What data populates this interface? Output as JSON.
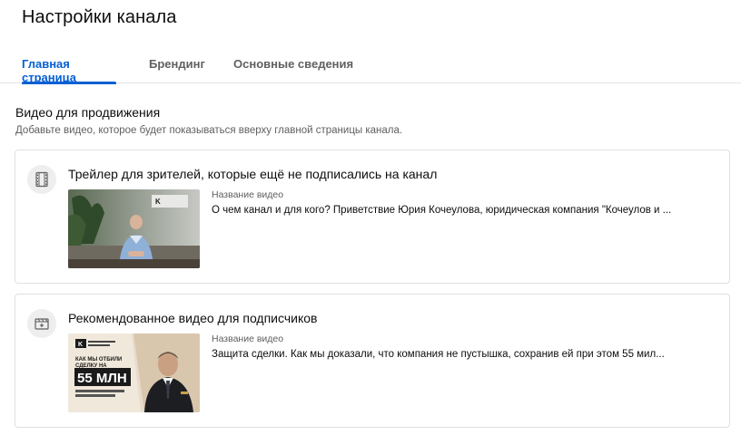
{
  "page": {
    "title": "Настройки канала"
  },
  "tabs": [
    {
      "label": "Главная страница",
      "active": true
    },
    {
      "label": "Брендинг",
      "active": false
    },
    {
      "label": "Основные сведения",
      "active": false
    }
  ],
  "section": {
    "title": "Видео для продвижения",
    "description": "Добавьте видео, которое будет показываться вверху главной страницы канала."
  },
  "cards": [
    {
      "icon": "film-strip-icon",
      "title": "Трейлер для зрителей, которые ещё не подписались на канал",
      "meta_label": "Название видео",
      "video_title": "О чем канал и для кого? Приветствие Юрия Кочеулова, юридическая компания \"Кочеулов и ...",
      "thumb_logo": "K"
    },
    {
      "icon": "clapperboard-add-icon",
      "title": "Рекомендованное видео для подписчиков",
      "meta_label": "Название видео",
      "video_title": "Защита сделки. Как мы доказали, что компания не пустышка, сохранив ей при этом 55 мил...",
      "thumb_logo": "K",
      "thumb_headline": "КАК МЫ ОТБИЛИ СДЕЛКУ НА",
      "thumb_amount": "55 МЛН"
    }
  ],
  "colors": {
    "accent": "#065fd4",
    "text_secondary": "#606060",
    "divider": "#e5e5e5"
  }
}
